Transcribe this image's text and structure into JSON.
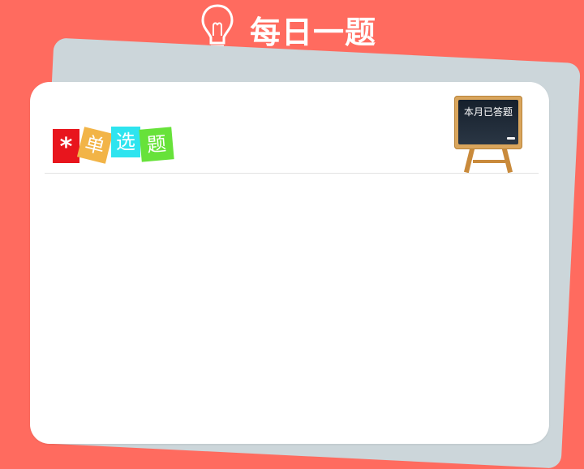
{
  "header": {
    "icon": "lightbulb-icon",
    "title": "每日一题"
  },
  "question": {
    "badge_chars": [
      "*",
      "单",
      "选",
      "题"
    ],
    "badge_colors": [
      "#e8151d",
      "#f2b447",
      "#2ee4ef",
      "#67e23a"
    ],
    "answered_label": "本月已答题"
  },
  "colors": {
    "background": "#ff6b5f",
    "card": "#ffffff",
    "card_back": "#ccd6da"
  }
}
